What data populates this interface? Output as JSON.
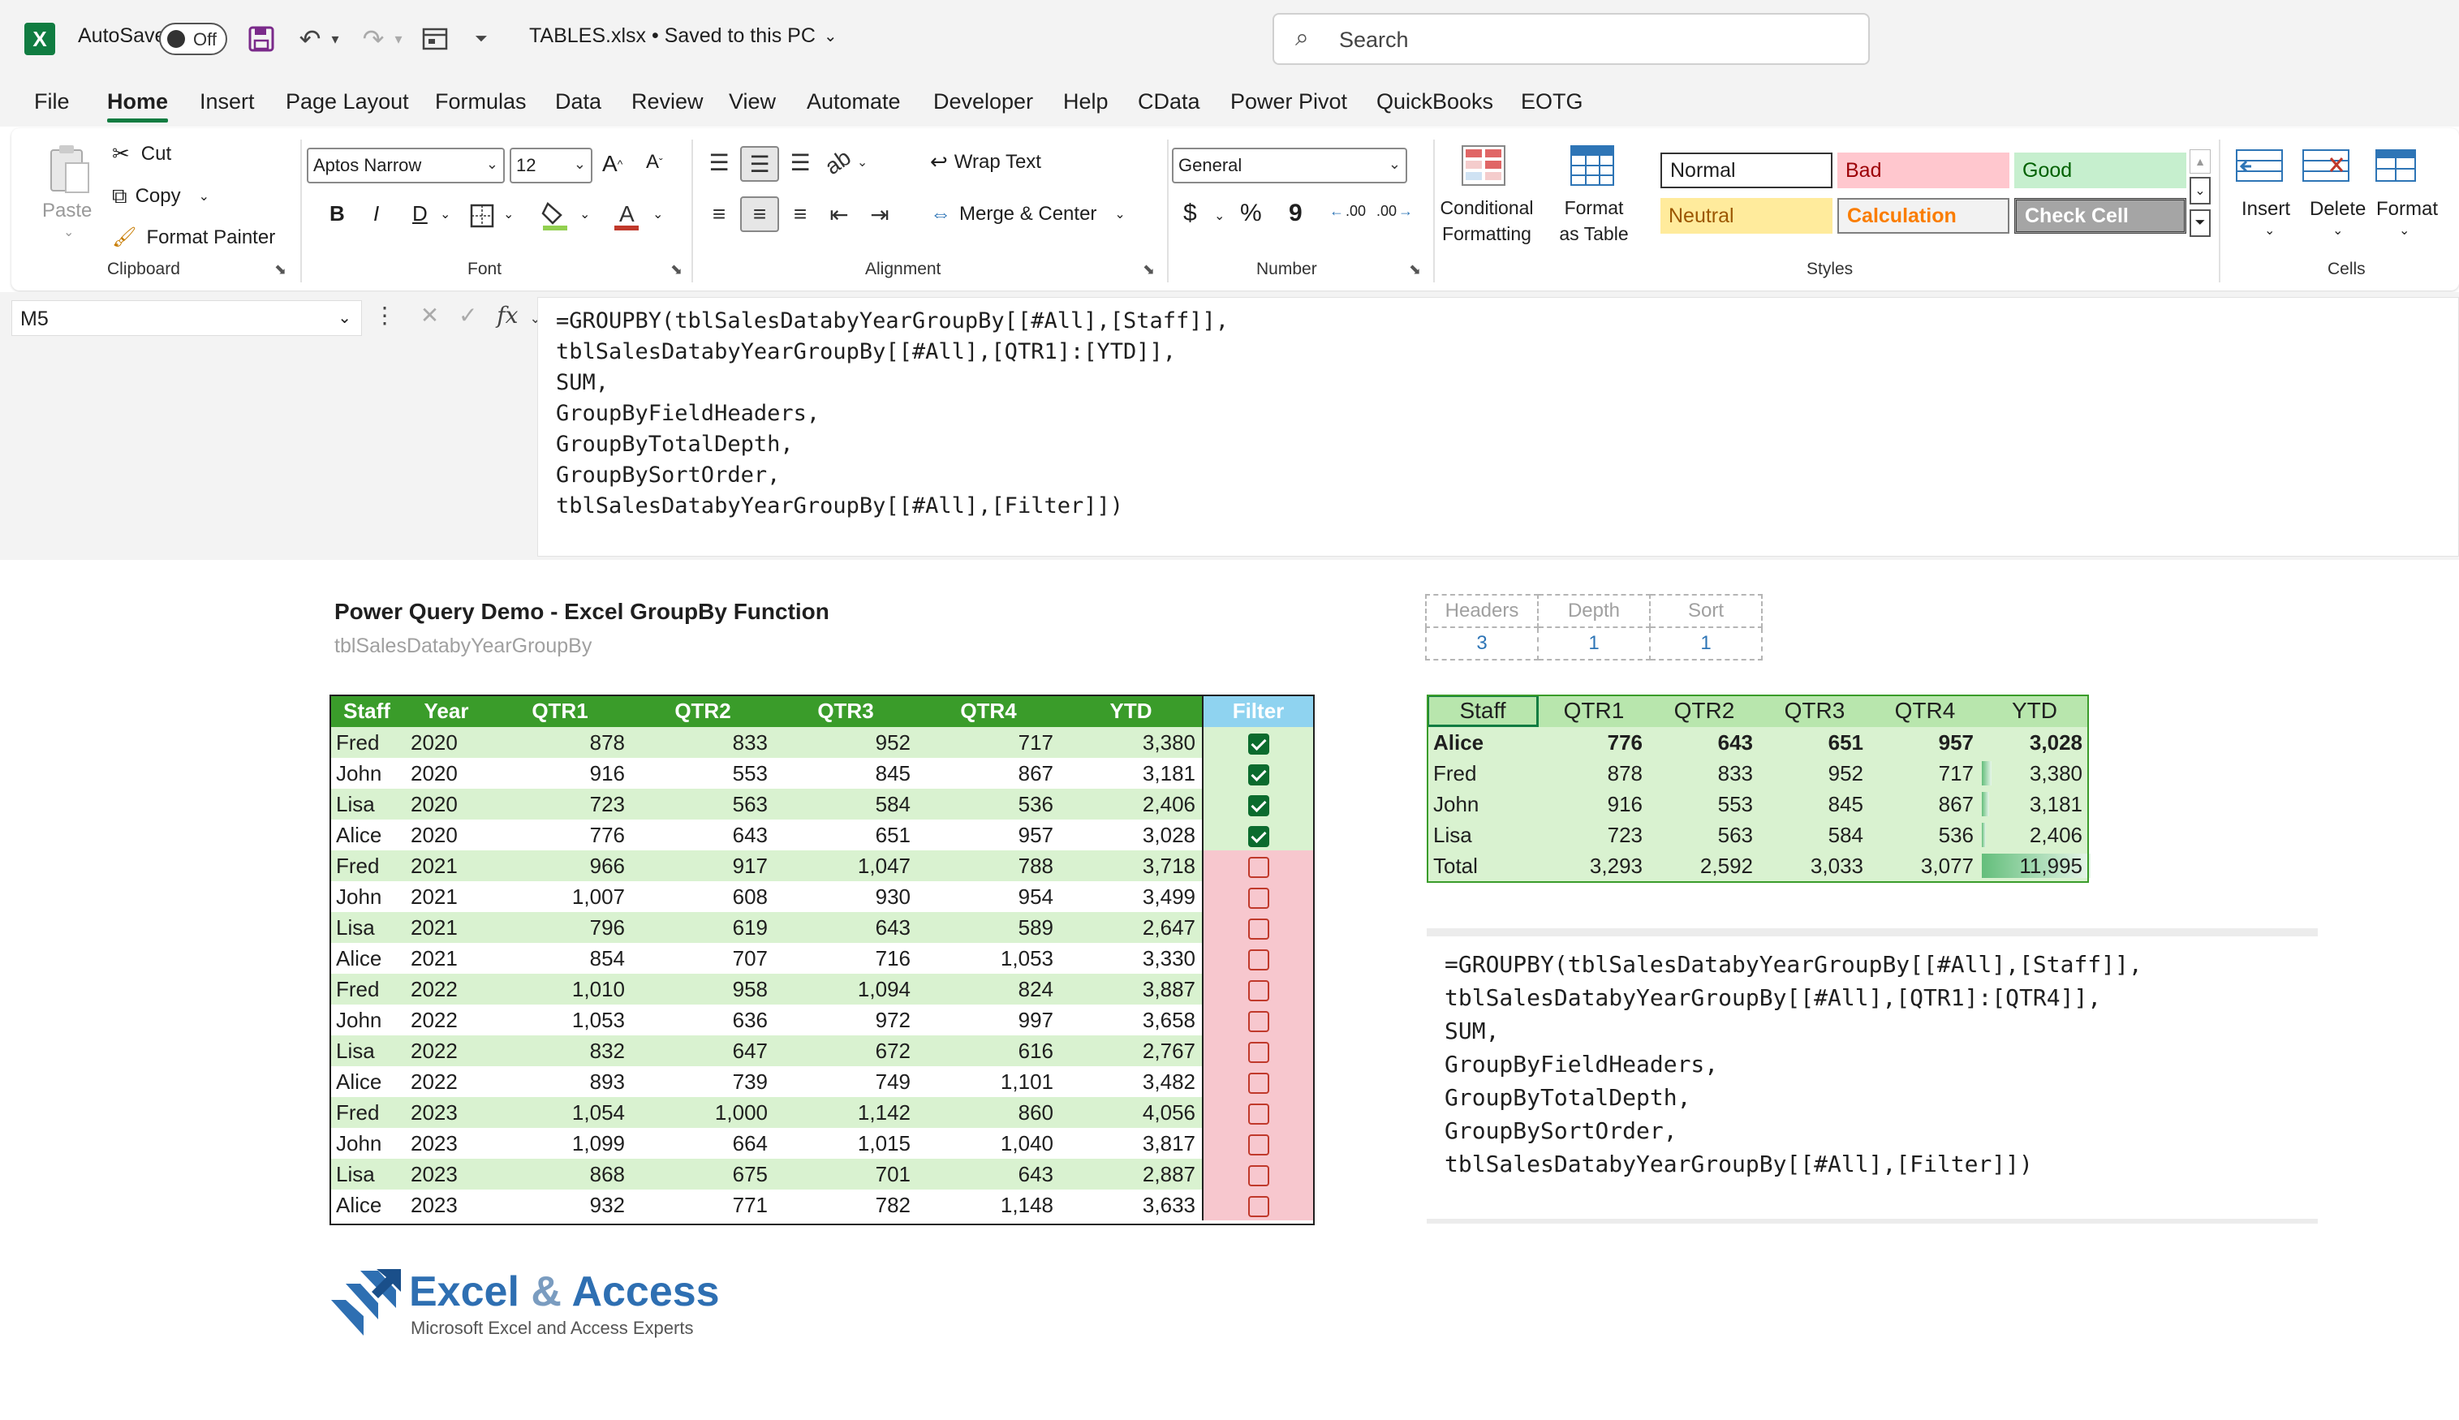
{
  "titlebar": {
    "autosave_label": "AutoSave",
    "autosave_state": "Off",
    "filename": "TABLES.xlsx • Saved to this PC",
    "search_placeholder": "Search"
  },
  "menu": {
    "tabs": [
      "File",
      "Home",
      "Insert",
      "Page Layout",
      "Formulas",
      "Data",
      "Review",
      "View",
      "Automate",
      "Developer",
      "Help",
      "CData",
      "Power Pivot",
      "QuickBooks",
      "EOTG"
    ],
    "active": "Home"
  },
  "ribbon": {
    "clipboard": {
      "paste": "Paste",
      "cut": "Cut",
      "copy": "Copy",
      "format_painter": "Format Painter",
      "label": "Clipboard"
    },
    "font": {
      "family": "Aptos Narrow",
      "size": "12",
      "label": "Font",
      "bold": "B",
      "italic": "I",
      "underline": "D",
      "increase": "A^",
      "decrease": "Aˇ",
      "font_color": "A"
    },
    "alignment": {
      "wrap_text": "Wrap Text",
      "merge_center": "Merge & Center",
      "label": "Alignment"
    },
    "number": {
      "format": "General",
      "currency": "$",
      "percent": "%",
      "comma": "9",
      "label": "Number",
      "inc_decimal": ".00",
      "dec_decimal": ".00"
    },
    "styles": {
      "conditional_formatting": "Conditional Formatting",
      "format_as_table": "Format as Table",
      "cells": [
        {
          "label": "Normal",
          "bg": "#ffffff",
          "color": "#000000"
        },
        {
          "label": "Bad",
          "bg": "#ffc7ce",
          "color": "#9c0006"
        },
        {
          "label": "Good",
          "bg": "#c6efce",
          "color": "#006100"
        },
        {
          "label": "Neutral",
          "bg": "#ffeb9c",
          "color": "#9c5700"
        },
        {
          "label": "Calculation",
          "bg": "#f2f2f2",
          "color": "#fa7d00"
        },
        {
          "label": "Check Cell",
          "bg": "#a5a5a5",
          "color": "#ffffff"
        }
      ],
      "label": "Styles"
    },
    "cells": {
      "insert": "Insert",
      "delete": "Delete",
      "format": "Format",
      "label": "Cells"
    }
  },
  "formula_bar": {
    "name_box": "M5",
    "formula": "=GROUPBY(tblSalesDatabyYearGroupBy[[#All],[Staff]],\ntblSalesDatabyYearGroupBy[[#All],[QTR1]:[YTD]],\nSUM,\nGroupByFieldHeaders,\nGroupByTotalDepth,\nGroupBySortOrder,\ntblSalesDatabyYearGroupBy[[#All],[Filter]])"
  },
  "sheet": {
    "title": "Power Query Demo - Excel GroupBy Function",
    "subtitle": "tblSalesDatabyYearGroupBy",
    "main_table": {
      "headers": [
        "Staff",
        "Year",
        "QTR1",
        "QTR2",
        "QTR3",
        "QTR4",
        "YTD",
        "Filter"
      ],
      "rows": [
        [
          "Fred",
          "2020",
          "878",
          "833",
          "952",
          "717",
          "3,380",
          true
        ],
        [
          "John",
          "2020",
          "916",
          "553",
          "845",
          "867",
          "3,181",
          true
        ],
        [
          "Lisa",
          "2020",
          "723",
          "563",
          "584",
          "536",
          "2,406",
          true
        ],
        [
          "Alice",
          "2020",
          "776",
          "643",
          "651",
          "957",
          "3,028",
          true
        ],
        [
          "Fred",
          "2021",
          "966",
          "917",
          "1,047",
          "788",
          "3,718",
          false
        ],
        [
          "John",
          "2021",
          "1,007",
          "608",
          "930",
          "954",
          "3,499",
          false
        ],
        [
          "Lisa",
          "2021",
          "796",
          "619",
          "643",
          "589",
          "2,647",
          false
        ],
        [
          "Alice",
          "2021",
          "854",
          "707",
          "716",
          "1,053",
          "3,330",
          false
        ],
        [
          "Fred",
          "2022",
          "1,010",
          "958",
          "1,094",
          "824",
          "3,887",
          false
        ],
        [
          "John",
          "2022",
          "1,053",
          "636",
          "972",
          "997",
          "3,658",
          false
        ],
        [
          "Lisa",
          "2022",
          "832",
          "647",
          "672",
          "616",
          "2,767",
          false
        ],
        [
          "Alice",
          "2022",
          "893",
          "739",
          "749",
          "1,101",
          "3,482",
          false
        ],
        [
          "Fred",
          "2023",
          "1,054",
          "1,000",
          "1,142",
          "860",
          "4,056",
          false
        ],
        [
          "John",
          "2023",
          "1,099",
          "664",
          "1,015",
          "1,040",
          "3,817",
          false
        ],
        [
          "Lisa",
          "2023",
          "868",
          "675",
          "701",
          "643",
          "2,887",
          false
        ],
        [
          "Alice",
          "2023",
          "932",
          "771",
          "782",
          "1,148",
          "3,633",
          false
        ]
      ]
    },
    "params": {
      "headers": [
        "Headers",
        "Depth",
        "Sort"
      ],
      "values": [
        "3",
        "1",
        "1"
      ]
    },
    "groupby_table": {
      "headers": [
        "Staff",
        "QTR1",
        "QTR2",
        "QTR3",
        "QTR4",
        "YTD"
      ],
      "rows": [
        {
          "cells": [
            "Alice",
            "776",
            "643",
            "651",
            "957",
            "3,028"
          ],
          "bar": 0
        },
        {
          "cells": [
            "Fred",
            "878",
            "833",
            "952",
            "717",
            "3,380"
          ],
          "bar": 0.09
        },
        {
          "cells": [
            "John",
            "916",
            "553",
            "845",
            "867",
            "3,181"
          ],
          "bar": 0.07
        },
        {
          "cells": [
            "Lisa",
            "723",
            "563",
            "584",
            "536",
            "2,406"
          ],
          "bar": 0.04
        },
        {
          "cells": [
            "Total",
            "3,293",
            "2,592",
            "3,033",
            "3,077",
            "11,995"
          ],
          "bar": 1.0
        }
      ]
    },
    "formula_box": "=GROUPBY(tblSalesDatabyYearGroupBy[[#All],[Staff]],\ntblSalesDatabyYearGroupBy[[#All],[QTR1]:[QTR4]],\nSUM,\nGroupByFieldHeaders,\nGroupByTotalDepth,\nGroupBySortOrder,\ntblSalesDatabyYearGroupBy[[#All],[Filter]])",
    "logo": {
      "name": "Excel & Access",
      "tagline": "Microsoft Excel and Access Experts"
    }
  }
}
